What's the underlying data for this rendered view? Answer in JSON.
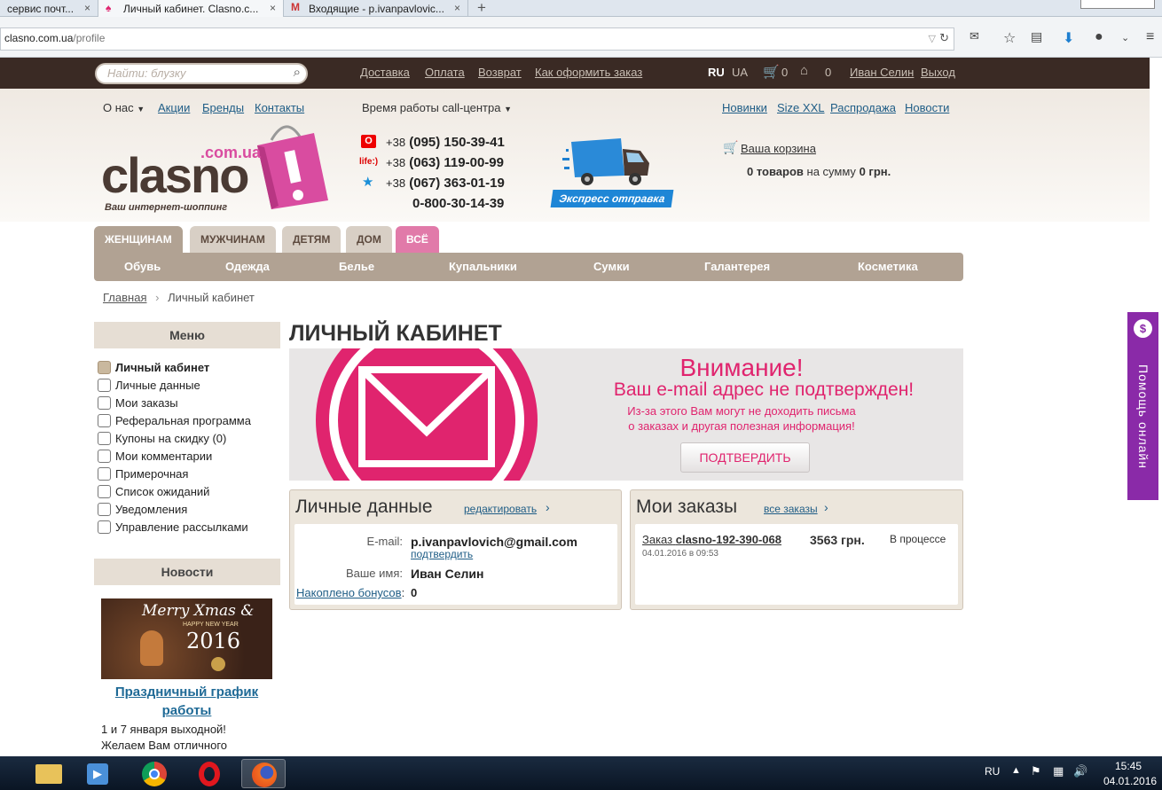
{
  "browser": {
    "tabs": [
      {
        "label": "сервис почт...",
        "close": "×"
      },
      {
        "label": "Личный кабинет. Clasno.c...",
        "close": "×"
      },
      {
        "label": "Входящие - p.ivanpavlovic...",
        "close": "×"
      }
    ],
    "new_tab": "+",
    "url_domain": "clasno.com.ua",
    "url_path": "/profile"
  },
  "topbar": {
    "search_placeholder": "Найти: блузку",
    "links": [
      "Доставка",
      "Оплата",
      "Возврат",
      "Как оформить заказ"
    ],
    "lang_ru": "RU",
    "lang_ua": "UA",
    "cart_count": "0",
    "wish_count": "0",
    "user_name": "Иван Селин",
    "logout": "Выход"
  },
  "header": {
    "about": "О нас",
    "links_left": [
      "Акции",
      "Бренды",
      "Контакты"
    ],
    "hours": "Время работы call-центра",
    "links_right": [
      "Новинки",
      "Size XXL",
      "Распродажа",
      "Новости"
    ],
    "logo_text": "clasno",
    "logo_suffix": ".com.ua",
    "logo_tagline": "Ваш интернет-шоппинг",
    "phones": [
      {
        "prefix": "+38",
        "number": "(095) 150-39-41",
        "op": "O"
      },
      {
        "prefix": "+38",
        "number": "(063) 119-00-99",
        "op": "life:)"
      },
      {
        "prefix": "+38",
        "number": "(067) 363-01-19",
        "op": "★"
      }
    ],
    "free_phone": "0-800-30-14-39",
    "express": "Экспресс отправка",
    "cart_title": "Ваша корзина",
    "cart_items": "0 товаров",
    "cart_middle": "на сумму",
    "cart_sum": "0 грн."
  },
  "categories": [
    "ЖЕНЩИНАМ",
    "МУЖЧИНАМ",
    "ДЕТЯМ",
    "ДОМ",
    "ВСЁ"
  ],
  "subcategories": [
    "Обувь",
    "Одежда",
    "Белье",
    "Купальники",
    "Сумки",
    "Галантерея",
    "Косметика"
  ],
  "breadcrumb": {
    "home": "Главная",
    "sep": "›",
    "current": "Личный кабинет"
  },
  "sidebar": {
    "menu_title": "Меню",
    "items": [
      "Личный кабинет",
      "Личные данные",
      "Мои заказы",
      "Реферальная программа",
      "Купоны на скидку (0)",
      "Мои комментарии",
      "Примерочная",
      "Список ожиданий",
      "Уведомления",
      "Управление рассылками"
    ],
    "news_title": "Новости",
    "news_image_text1": "Merry Xmas &",
    "news_image_text2": "HAPPY NEW YEAR",
    "news_image_year": "2016",
    "news_link": "Праздничный график работы",
    "news_text1": "1 и 7 января выходной!",
    "news_text2": "Желаем Вам отличного"
  },
  "main": {
    "title": "ЛИЧНЫЙ КАБИНЕТ",
    "alert_title": "Внимание!",
    "alert_subtitle": "Ваш e-mail адрес не подтвержден!",
    "alert_line1": "Из-за этого Вам могут не доходить письма",
    "alert_line2": "о заказах и другая полезная информация!",
    "alert_button": "ПОДТВЕРДИТЬ",
    "personal": {
      "title": "Личные данные",
      "edit": "редактировать",
      "email_label": "E-mail:",
      "email": "p.ivanpavlovich@gmail.com",
      "confirm": "подтвердить",
      "name_label": "Ваше имя:",
      "name": "Иван Селин",
      "bonus_label": "Накоплено бонусов",
      "bonus_colon": ":",
      "bonus": "0"
    },
    "orders": {
      "title": "Мои заказы",
      "all": "все заказы",
      "order_prefix": "Заказ",
      "order_id": "clasno-192-390-068",
      "order_sum": "3563 грн.",
      "order_status": "В процессе",
      "order_date": "04.01.2016 в 09:53"
    }
  },
  "help_tab": "Помощь онлайн",
  "taskbar": {
    "lang": "RU",
    "time": "15:45",
    "date": "04.01.2016"
  },
  "colors": {
    "brand_pink": "#e0246e",
    "header_dark": "#3a2a24",
    "link": "#1f5d86",
    "nav_bg": "#b1a293"
  }
}
